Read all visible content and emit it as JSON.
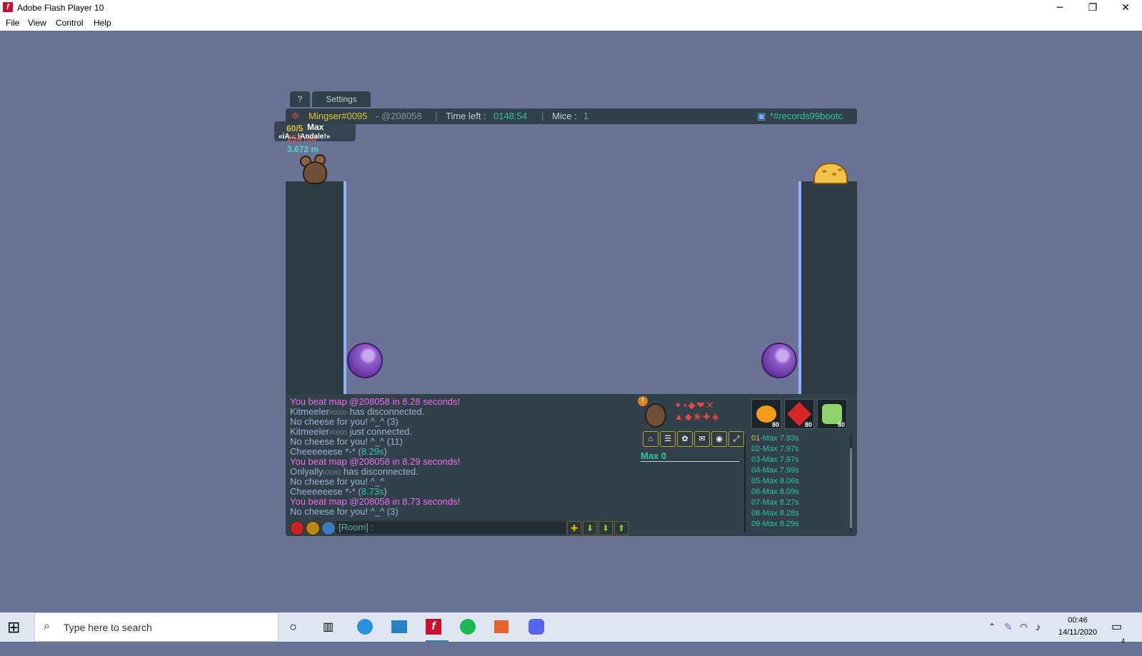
{
  "window": {
    "title": "Adobe Flash Player 10",
    "minimize": "─",
    "restore": "❐",
    "close": "✕"
  },
  "menu": [
    "File",
    "View",
    "Control",
    "Help"
  ],
  "tabs": {
    "help": "?",
    "settings": "Settings"
  },
  "hud": {
    "player": "Mingser#0095",
    "map": "- @208058",
    "time_label": "Time left :",
    "time_value": "0148:54",
    "mice_label": "Mice :",
    "mice_value": "1",
    "room": "*#records99bootc"
  },
  "overlay": {
    "counter": "60/5",
    "name": "Max",
    "distance1": "254 md",
    "title_tag": "«iA... !Andale!»",
    "distance2": "3.672 m"
  },
  "chat": {
    "lines": [
      {
        "text": "You beat map @208058 in 8.28 seconds!",
        "color": "#f06cf0"
      },
      {
        "text": "Kitmeeler",
        "tag": "#0000",
        "suffix": " has disconnected.",
        "color": "#99b2d6"
      },
      {
        "text": "No cheese for you! ^_^ (3)",
        "color": "#99b2d6"
      },
      {
        "text": "Kitmeeler",
        "tag": "#0000",
        "suffix": " just connected.",
        "color": "#99b2d6"
      },
      {
        "text": "No cheese for you! ^_^ (11)",
        "color": "#99b2d6"
      },
      {
        "text": "Cheeeeeese *-* (",
        "value": "8.29s",
        "suffix": ")",
        "color": "#99b2d6"
      },
      {
        "text": "You beat map @208058 in 8.29 seconds!",
        "color": "#f06cf0"
      },
      {
        "text": "Onlyally",
        "tag": "#3082",
        "suffix": " has disconnected.",
        "color": "#99b2d6"
      },
      {
        "text": "No cheese for you! ^_^",
        "color": "#99b2d6"
      },
      {
        "text": "Cheeeeeese *-* (",
        "value": "8.73s",
        "suffix": ")",
        "color": "#99b2d6"
      },
      {
        "text": "You beat map @208058 in 8.73 seconds!",
        "color": "#f06cf0"
      },
      {
        "text": "No cheese for you! ^_^ (3)",
        "color": "#99b2d6"
      }
    ],
    "input_placeholder": "[Room] :"
  },
  "shortcuts": [
    "home-icon",
    "list-icon",
    "shop-icon",
    "chat-icon",
    "discord-icon",
    "fullscreen-icon"
  ],
  "badges": [
    {
      "icon": "pumpkin-icon",
      "count": "80"
    },
    {
      "icon": "butterfly-icon",
      "count": "80"
    },
    {
      "icon": "clover-icon",
      "count": "80"
    }
  ],
  "score": {
    "label": "Max 0"
  },
  "records": [
    {
      "rank": "01",
      "entry": "-Max 7.93s"
    },
    {
      "rank": "02",
      "entry": "-Max 7.97s"
    },
    {
      "rank": "03",
      "entry": "-Max 7.97s"
    },
    {
      "rank": "04",
      "entry": "-Max 7.99s"
    },
    {
      "rank": "05",
      "entry": "-Max 8.06s"
    },
    {
      "rank": "06",
      "entry": "-Max 8.09s"
    },
    {
      "rank": "07",
      "entry": "-Max 8.27s"
    },
    {
      "rank": "08",
      "entry": "-Max 8.28s"
    },
    {
      "rank": "09",
      "entry": "-Max 8.29s"
    }
  ],
  "taskbar": {
    "search": "Type here to search",
    "time": "00:46",
    "date": "14/11/2020",
    "notifications": "4"
  },
  "colors": {
    "panel": "#324049",
    "stage": "#6a7396",
    "accent": "#2fc4a8",
    "gold": "#d6c23a",
    "pink": "#f06cf0"
  }
}
